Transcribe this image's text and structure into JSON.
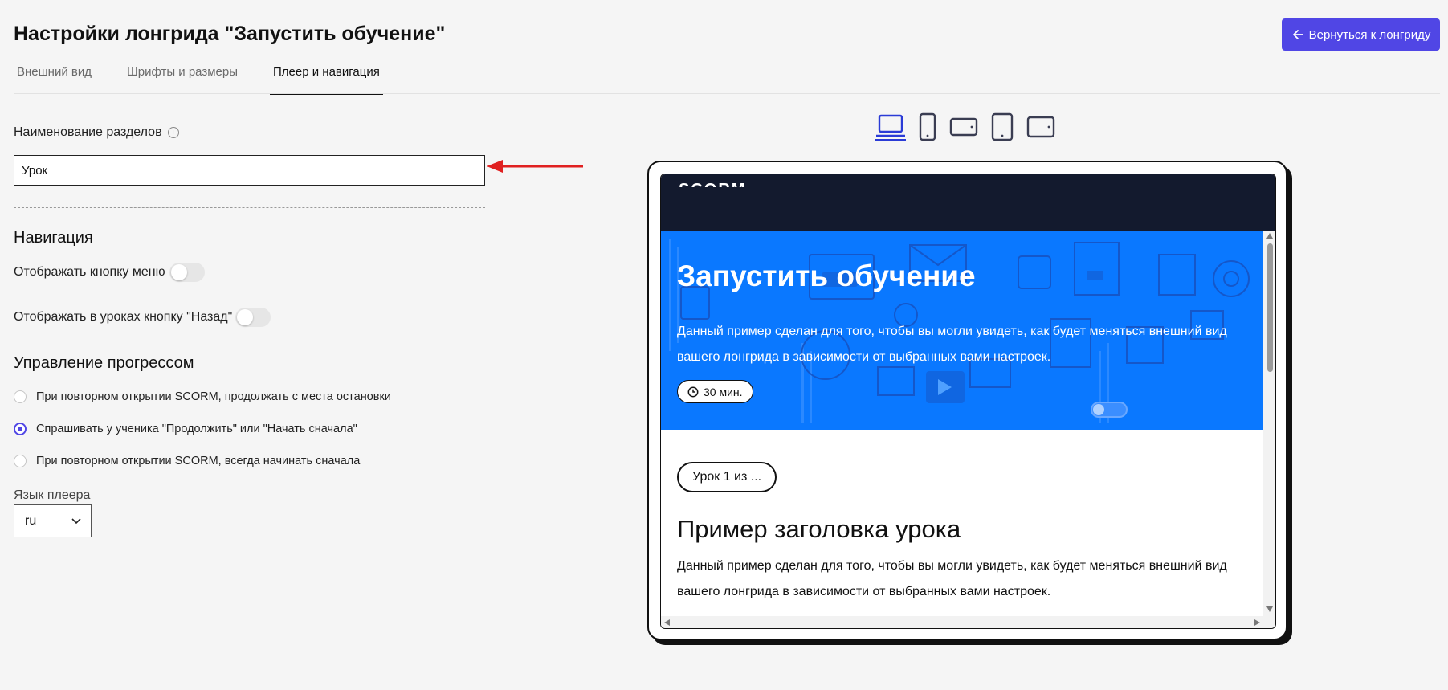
{
  "header": {
    "title": "Настройки лонгрида \"Запустить обучение\"",
    "back_button_label": "Вернуться к лонгриду",
    "back_button_color": "#5046e5"
  },
  "tabs": [
    {
      "label": "Внешний вид",
      "active": false
    },
    {
      "label": "Шрифты и размеры",
      "active": false
    },
    {
      "label": "Плеер и навигация",
      "active": true
    }
  ],
  "section_naming": {
    "label": "Наименование разделов",
    "value": "Урок"
  },
  "navigation": {
    "title": "Навигация",
    "show_menu_button": {
      "label": "Отображать кнопку меню",
      "enabled": false
    },
    "show_back_button": {
      "label": "Отображать в уроках кнопку \"Назад\"",
      "enabled": false
    }
  },
  "progress": {
    "title": "Управление прогрессом",
    "options": [
      {
        "label": "При повторном открытии SCORM, продолжать с места остановки",
        "checked": false
      },
      {
        "label": "Спрашивать у ученика \"Продолжить\" или \"Начать сначала\"",
        "checked": true
      },
      {
        "label": "При повторном открытии SCORM, всегда начинать сначала",
        "checked": false
      }
    ]
  },
  "player_language": {
    "label": "Язык плеера",
    "value": "ru"
  },
  "devices": [
    {
      "icon": "laptop-icon",
      "selected": true
    },
    {
      "icon": "phone-portrait-icon",
      "selected": false
    },
    {
      "icon": "phone-landscape-icon",
      "selected": false
    },
    {
      "icon": "tablet-portrait-icon",
      "selected": false
    },
    {
      "icon": "tablet-landscape-icon",
      "selected": false
    }
  ],
  "preview": {
    "logo": "SCORM",
    "hero_title": "Запустить обучение",
    "hero_description": "Данный пример сделан для того, чтобы вы могли увидеть, как будет меняться внешний вид вашего лонгрида в зависимости от выбранных вами настроек.",
    "duration": "30 мин.",
    "lesson_chip": "Урок 1 из ...",
    "lesson_title": "Пример заголовка урока",
    "lesson_description": "Данный пример сделан для того, чтобы вы могли увидеть, как будет меняться внешний вид вашего лонгрида в зависимости от выбранных вами настроек.",
    "hero_color": "#0a78ff",
    "header_color": "#131a2e"
  },
  "annotation": {
    "color": "#e02020"
  }
}
